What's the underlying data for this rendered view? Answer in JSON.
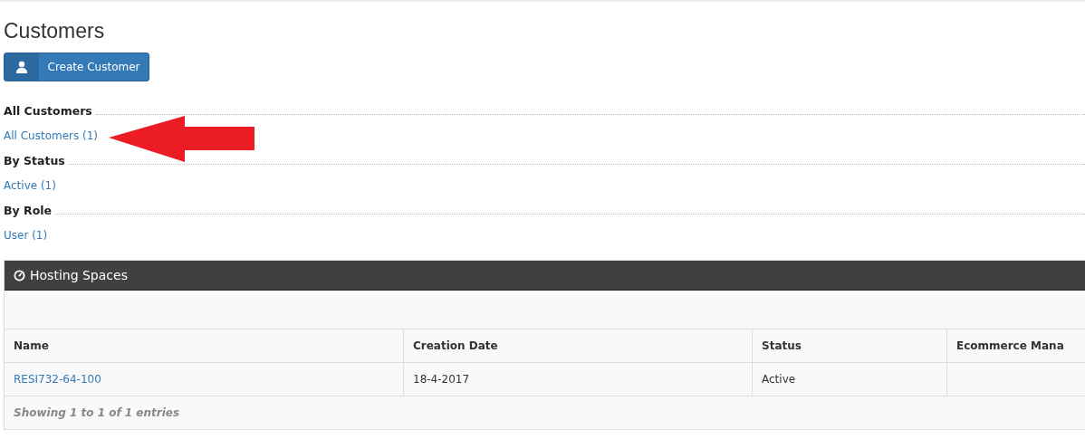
{
  "page": {
    "title": "Customers"
  },
  "create_button": {
    "label": "Create Customer"
  },
  "filter_groups": [
    {
      "title": "All Customers",
      "links": [
        "All Customers (1)"
      ]
    },
    {
      "title": "By Status",
      "links": [
        "Active (1)"
      ]
    },
    {
      "title": "By Role",
      "links": [
        "User (1)"
      ]
    }
  ],
  "panel": {
    "title": "Hosting Spaces",
    "table": {
      "columns": [
        "Name",
        "Creation Date",
        "Status",
        "Ecommerce Mana"
      ],
      "rows": [
        [
          "RESI732-64-100",
          "18-4-2017",
          "Active",
          ""
        ]
      ]
    },
    "footer": "Showing 1 to 1 of 1 entries"
  }
}
